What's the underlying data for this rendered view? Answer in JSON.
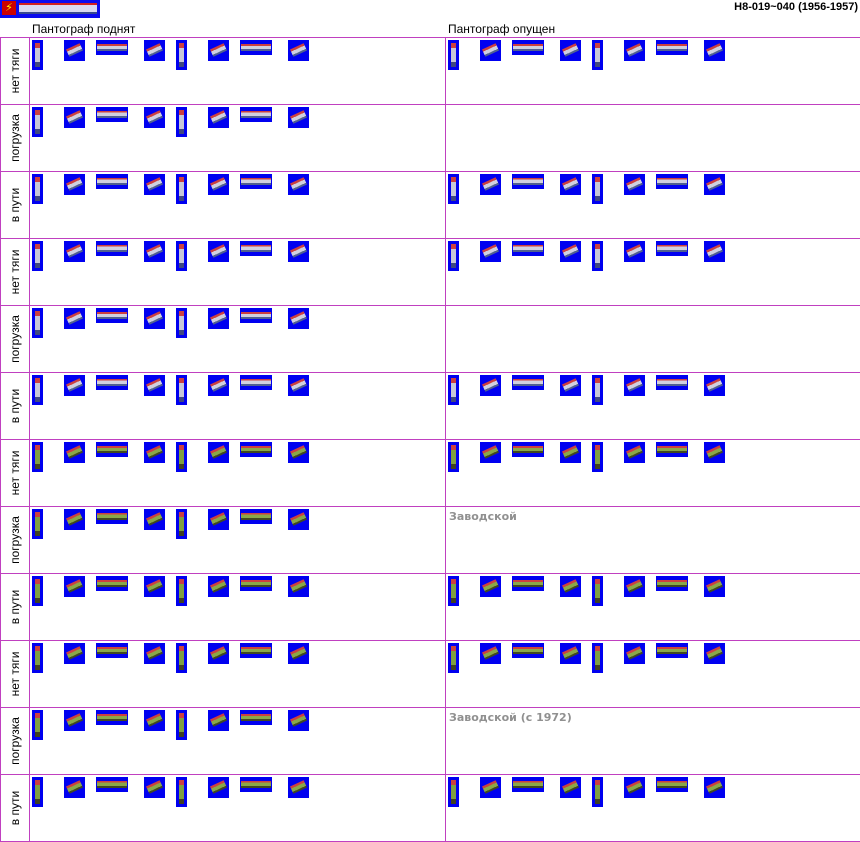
{
  "title": "Н8-019~040 (1956-1957)",
  "columns": {
    "up": "Пантограф поднят",
    "down": "Пантограф опущен"
  },
  "rows": [
    {
      "label": "нет тяги",
      "color": "grey",
      "right": "sprites",
      "right_label": ""
    },
    {
      "label": "погрузка",
      "color": "grey",
      "right": "empty",
      "right_label": ""
    },
    {
      "label": "в пути",
      "color": "grey",
      "right": "sprites",
      "right_label": ""
    },
    {
      "label": "нет тяги",
      "color": "grey",
      "right": "sprites",
      "right_label": ""
    },
    {
      "label": "погрузка",
      "color": "grey",
      "right": "empty",
      "right_label": ""
    },
    {
      "label": "в пути",
      "color": "grey",
      "right": "sprites",
      "right_label": ""
    },
    {
      "label": "нет тяги",
      "color": "green",
      "right": "sprites",
      "right_label": ""
    },
    {
      "label": "погрузка",
      "color": "green",
      "right": "label",
      "right_label": "Заводской"
    },
    {
      "label": "в пути",
      "color": "green",
      "right": "sprites",
      "right_label": ""
    },
    {
      "label": "нет тяги",
      "color": "green",
      "right": "sprites",
      "right_label": ""
    },
    {
      "label": "погрузка",
      "color": "green",
      "right": "label",
      "right_label": "Заводской (с 1972)"
    },
    {
      "label": "в пути",
      "color": "green",
      "right": "sprites",
      "right_label": ""
    }
  ],
  "icons": {
    "logo": "electric-locomotive-icon"
  },
  "colors": {
    "grid_border": "#c040c0",
    "sprite_bg": "#0000f0",
    "note_text": "#909090"
  }
}
